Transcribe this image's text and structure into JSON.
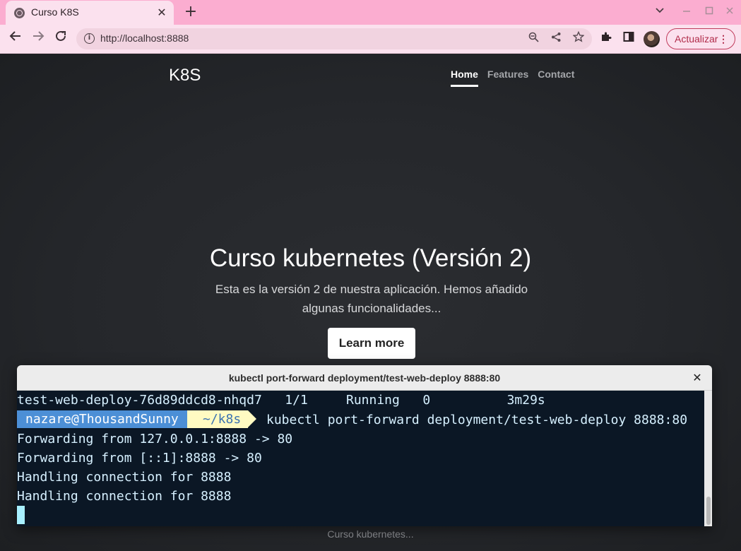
{
  "browser": {
    "tab_title": "Curso K8S",
    "tab_close": "✕",
    "new_tab": "+",
    "url": "http://localhost:8888",
    "update_label": "Actualizar"
  },
  "site": {
    "brand": "K8S",
    "nav": [
      {
        "label": "Home",
        "active": true
      },
      {
        "label": "Features",
        "active": false
      },
      {
        "label": "Contact",
        "active": false
      }
    ],
    "hero_title": "Curso kubernetes (Versión 2)",
    "hero_lead": "Esta es la versión 2 de nuestra aplicación. Hemos añadido algunas funcionalidades...",
    "learn_more": "Learn more",
    "footer": "Curso kubernetes..."
  },
  "terminal": {
    "title": "kubectl port-forward deployment/test-web-deploy 8888:80",
    "close": "✕",
    "line_pod": "test-web-deploy-76d89ddcd8-nhqd7   1/1     Running   0          3m29s",
    "prompt_user": "nazare@ThousandSunny",
    "prompt_dir": "~/k8s",
    "prompt_cmd": "kubectl port-forward deployment/test-web-deploy 8888:80",
    "output": [
      "Forwarding from 127.0.0.1:8888 -> 80",
      "Forwarding from [::1]:8888 -> 80",
      "Handling connection for 8888",
      "Handling connection for 8888"
    ]
  },
  "colors": {
    "tabbar": "#fbadd0",
    "toolbar": "#fbe1ee",
    "terminal_bg": "#0b1725",
    "prompt_user_bg": "#4c8fd6",
    "prompt_dir_bg": "#fffbc2"
  }
}
